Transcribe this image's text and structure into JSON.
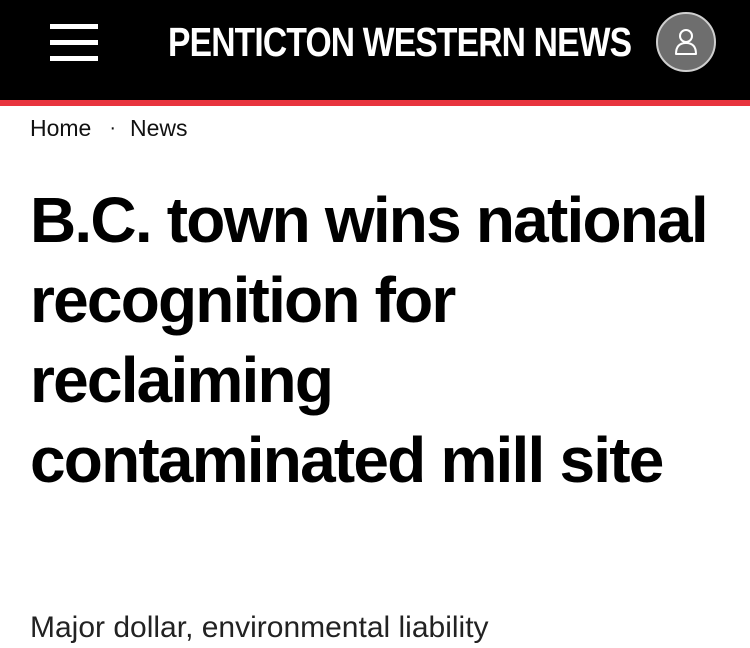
{
  "header": {
    "brand": "PENTICTON WESTERN NEWS",
    "menu_icon": "hamburger-menu-icon",
    "account_icon": "user-icon",
    "background_color": "#000000",
    "accent_color": "#e8343e"
  },
  "breadcrumb": {
    "home": "Home",
    "separator": "·",
    "section": "News"
  },
  "article": {
    "headline": "B.C. town wins national recognition for reclaiming contaminated mill site",
    "subheadline": "Major dollar, environmental liability"
  }
}
